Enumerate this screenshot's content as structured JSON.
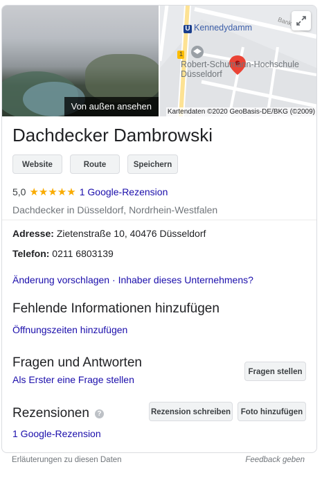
{
  "media": {
    "photo_caption": "Von außen ansehen",
    "map": {
      "station_label": "Kennedydamm",
      "station_letter": "U",
      "school_label_line1": "Robert-Schumann-Hochschule",
      "school_label_line2": "Düsseldorf",
      "street_label": "Bank",
      "road_number": "1",
      "attribution": "Kartendaten ©2020 GeoBasis-DE/BKG (©2009)",
      "expand_icon": "expand-icon",
      "marker_icon": "map-pin-icon"
    }
  },
  "business": {
    "name": "Dachdecker Dambrowski",
    "buttons": {
      "website": "Website",
      "route": "Route",
      "save": "Speichern"
    },
    "rating_value": "5,0",
    "stars": "★★★★★",
    "review_link": "1 Google-Rezension",
    "category": "Dachdecker in Düsseldorf, Nordrhein-Westfalen"
  },
  "details": {
    "address_label": "Adresse:",
    "address_value": "Zietenstraße 10, 40476 Düsseldorf",
    "phone_label": "Telefon:",
    "phone_value": "0211 6803139",
    "suggest_edit": "Änderung vorschlagen",
    "separator": "·",
    "owner_link": "Inhaber dieses Unternehmens?"
  },
  "missing_info": {
    "heading": "Fehlende Informationen hinzufügen",
    "add_hours": "Öffnungszeiten hinzufügen"
  },
  "qa": {
    "heading": "Fragen und Antworten",
    "first_question": "Als Erster eine Frage stellen",
    "ask_button": "Fragen stellen"
  },
  "reviews": {
    "heading": "Rezensionen",
    "help_icon": "help-icon",
    "write_button": "Rezension schreiben",
    "photo_button": "Foto hinzufügen",
    "review_link": "1 Google-Rezension"
  },
  "footer": {
    "explanation": "Erläuterungen zu diesen Daten",
    "feedback": "Feedback geben"
  },
  "colors": {
    "link": "#1a0dab",
    "star": "#f9ab00",
    "pin": "#ea4335",
    "text_secondary": "#70757a"
  }
}
